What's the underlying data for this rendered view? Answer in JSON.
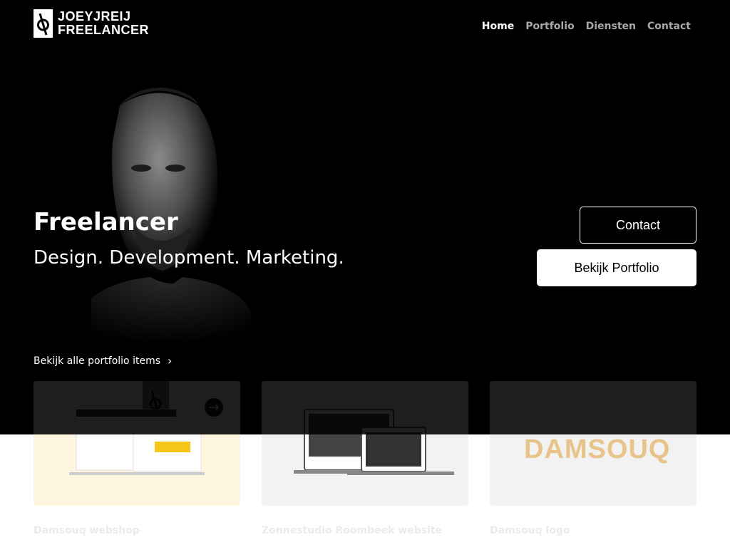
{
  "brand": {
    "line1": "JOEYJREIJ",
    "line2": "FREELANCER",
    "icon": "logo-mark-icon"
  },
  "nav": {
    "items": [
      {
        "label": "Home",
        "active": true
      },
      {
        "label": "Portfolio",
        "active": false
      },
      {
        "label": "Diensten",
        "active": false
      },
      {
        "label": "Contact",
        "active": false
      }
    ]
  },
  "hero": {
    "title": "Freelancer",
    "subtitle": "Design. Development. Marketing.",
    "contact_button": "Contact",
    "portfolio_button": "Bekijk Portfolio"
  },
  "portfolio": {
    "all_link": "Bekijk alle portfolio items",
    "items": [
      {
        "title": "Damsouq webshop",
        "bg": "#fff7e6"
      },
      {
        "title": "Zonnestudio Roombeek website",
        "bg": "#f2f2f2"
      },
      {
        "title": "Damsouq logo",
        "bg": "#f2f2f2",
        "logo_text": "DAMSOUQ"
      }
    ]
  },
  "colors": {
    "background": "#000000",
    "text": "#ffffff",
    "nav_inactive": "#a9a9a9"
  }
}
